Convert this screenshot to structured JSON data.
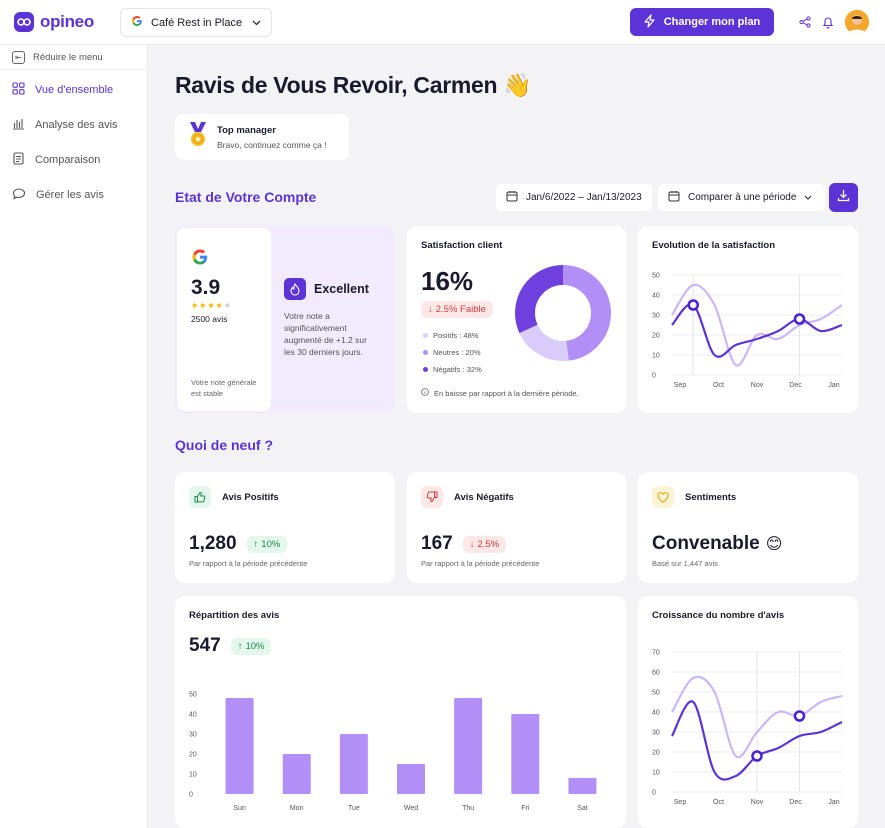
{
  "app": {
    "brand": "opineo",
    "business": "Café Rest in Place",
    "plan_button": "Changer mon plan"
  },
  "sidebar": {
    "collapse_label": "Réduire le menu",
    "items": [
      {
        "label": "Vue d'ensemble",
        "icon": "grid-icon",
        "active": true
      },
      {
        "label": "Analyse des avis",
        "icon": "bar-chart-icon",
        "active": false
      },
      {
        "label": "Comparaison",
        "icon": "document-icon",
        "active": false
      },
      {
        "label": "Gérer les avis",
        "icon": "chat-icon",
        "active": false
      }
    ]
  },
  "greeting": {
    "text": "Ravis de Vous Revoir, Carmen",
    "emoji": "👋"
  },
  "badge": {
    "title": "Top manager",
    "subtitle": "Bravo, continuez comme ça !"
  },
  "account": {
    "title": "Etat de Votre Compte",
    "date_range": "Jan/6/2022 – Jan/13/2023",
    "compare_label": "Comparer à une période",
    "rating": {
      "score": "3.9",
      "stars": 4,
      "reviews": "2500 avis",
      "stable_note": "Votre note générale est stable"
    },
    "excellent": {
      "label": "Excellent",
      "text": "Votre note a significativement augmenté de +1.2 sur les 30 derniers jours."
    },
    "satisfaction": {
      "title": "Satisfaction client",
      "value": "16%",
      "change": "2.5% Faible",
      "legend": [
        {
          "label": "Positifs : 48%",
          "color": "#d9ccfb"
        },
        {
          "label": "Neutres : 20%",
          "color": "#b28ff6"
        },
        {
          "label": "Négatifs : 32%",
          "color": "#7040de"
        }
      ],
      "footnote": "En baisse par rapport à la dernière période."
    }
  },
  "news": {
    "title": "Quoi de neuf ?",
    "positive": {
      "title": "Avis Positifs",
      "value": "1,280",
      "change": "10%",
      "sub": "Par rapport à la période précédente"
    },
    "negative": {
      "title": "Avis Négatifs",
      "value": "167",
      "change": "2.5%",
      "sub": "Par rapport à la période précédente"
    },
    "sentiment": {
      "title": "Sentiments",
      "value": "Convenable",
      "emoji": "😊",
      "sub": "Basé sur 1,447 avis"
    },
    "distribution": {
      "title": "Répartition des avis",
      "value": "547",
      "change": "10%"
    },
    "growth": {
      "title": "Croissance du nombre d'avis"
    }
  },
  "chart_data": [
    {
      "type": "pie",
      "title": "Satisfaction client",
      "categories": [
        "Positifs",
        "Neutres",
        "Négatifs"
      ],
      "values": [
        48,
        20,
        32
      ],
      "colors": [
        "#b28ff6",
        "#d9ccfb",
        "#7040de"
      ]
    },
    {
      "type": "line",
      "title": "Evolution de la satisfaction",
      "categories": [
        "Sep",
        "Oct",
        "Nov",
        "Dec",
        "Jan"
      ],
      "ylim": [
        0,
        50
      ],
      "yticks": [
        0,
        10,
        20,
        30,
        40,
        50
      ],
      "series": [
        {
          "color": "#cbb7f8",
          "values": [
            30,
            45,
            35,
            5,
            20,
            18,
            25,
            28,
            35
          ]
        },
        {
          "color": "#5b33d6",
          "values": [
            25,
            35,
            10,
            15,
            18,
            22,
            28,
            22,
            25
          ]
        }
      ],
      "markers": [
        {
          "series": 1,
          "index": 1
        },
        {
          "series": 1,
          "index": 6
        }
      ]
    },
    {
      "type": "bar",
      "title": "Répartition des avis",
      "categories": [
        "Sun",
        "Mon",
        "Tue",
        "Wed",
        "Thu",
        "Fri",
        "Sat"
      ],
      "values": [
        48,
        20,
        30,
        15,
        48,
        40,
        8
      ],
      "ylim": [
        0,
        50
      ],
      "yticks": [
        0,
        10,
        20,
        30,
        40,
        50
      ],
      "color": "#b28ff6"
    },
    {
      "type": "line",
      "title": "Croissance du nombre d'avis",
      "categories": [
        "Sep",
        "Oct",
        "Nov",
        "Dec",
        "Jan"
      ],
      "ylim": [
        0,
        70
      ],
      "yticks": [
        0,
        10,
        20,
        30,
        40,
        50,
        60,
        70
      ],
      "series": [
        {
          "color": "#cbb7f8",
          "values": [
            40,
            57,
            50,
            18,
            30,
            40,
            38,
            45,
            48
          ]
        },
        {
          "color": "#5b33d6",
          "values": [
            28,
            45,
            10,
            8,
            18,
            22,
            28,
            30,
            35
          ]
        }
      ],
      "markers": [
        {
          "series": 0,
          "index": 6
        },
        {
          "series": 1,
          "index": 4
        }
      ]
    }
  ]
}
